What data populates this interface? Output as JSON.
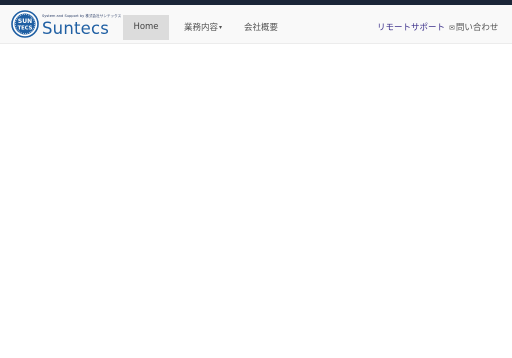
{
  "header": {
    "tagline": "System and Support by 株式会社サンテックス",
    "brand": "Suntecs",
    "seal_text_top": "SUN",
    "seal_text_bottom": "TECS"
  },
  "nav": {
    "home": "Home",
    "services": "業務内容",
    "company": "会社概要",
    "remote_support": "リモートサポート",
    "contact": "問い合わせ"
  },
  "colors": {
    "topbar": "#1b2638",
    "brand": "#1f5fa3",
    "active_tab": "#dcdcdc",
    "remote_link": "#3b2f8a"
  },
  "icons": {
    "seal": "suntecs-seal-logo",
    "services_caret": "caret-down-icon",
    "contact": "mail-icon"
  }
}
